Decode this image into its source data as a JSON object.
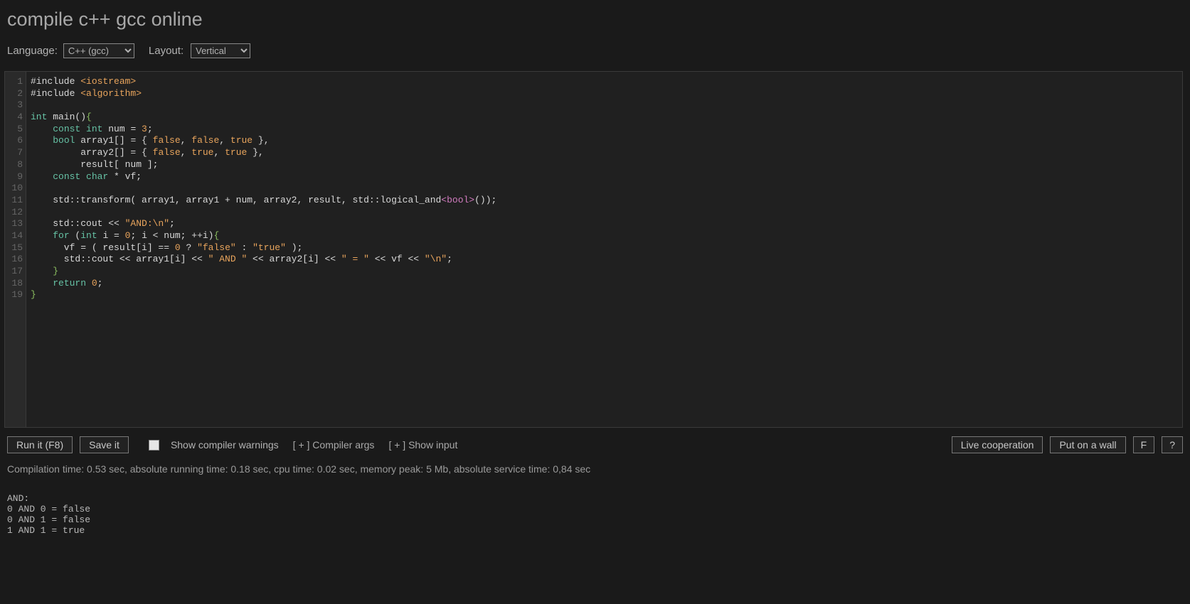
{
  "page_title": "compile c++ gcc online",
  "toolbar": {
    "language_label": "Language:",
    "language_value": "C++ (gcc)",
    "layout_label": "Layout:",
    "layout_value": "Vertical"
  },
  "editor": {
    "line_count": 19,
    "lines": [
      [
        {
          "t": "#include ",
          "c": ""
        },
        {
          "t": "<iostream>",
          "c": "fn"
        }
      ],
      [
        {
          "t": "#include ",
          "c": ""
        },
        {
          "t": "<algorithm>",
          "c": "fn"
        }
      ],
      [
        {
          "t": "",
          "c": ""
        }
      ],
      [
        {
          "t": "int",
          "c": "kw"
        },
        {
          "t": " main()",
          "c": ""
        },
        {
          "t": "{",
          "c": "brc"
        }
      ],
      [
        {
          "t": "    ",
          "c": ""
        },
        {
          "t": "const int",
          "c": "kw"
        },
        {
          "t": " num = ",
          "c": ""
        },
        {
          "t": "3",
          "c": "num"
        },
        {
          "t": ";",
          "c": ""
        }
      ],
      [
        {
          "t": "    ",
          "c": ""
        },
        {
          "t": "bool",
          "c": "kw"
        },
        {
          "t": " array1[] = { ",
          "c": ""
        },
        {
          "t": "false",
          "c": "bool"
        },
        {
          "t": ", ",
          "c": ""
        },
        {
          "t": "false",
          "c": "bool"
        },
        {
          "t": ", ",
          "c": ""
        },
        {
          "t": "true",
          "c": "bool"
        },
        {
          "t": " },",
          "c": ""
        }
      ],
      [
        {
          "t": "         array2[] = { ",
          "c": ""
        },
        {
          "t": "false",
          "c": "bool"
        },
        {
          "t": ", ",
          "c": ""
        },
        {
          "t": "true",
          "c": "bool"
        },
        {
          "t": ", ",
          "c": ""
        },
        {
          "t": "true",
          "c": "bool"
        },
        {
          "t": " },",
          "c": ""
        }
      ],
      [
        {
          "t": "         result[ num ];",
          "c": ""
        }
      ],
      [
        {
          "t": "    ",
          "c": ""
        },
        {
          "t": "const char",
          "c": "kw"
        },
        {
          "t": " * vf;",
          "c": ""
        }
      ],
      [
        {
          "t": "",
          "c": ""
        }
      ],
      [
        {
          "t": "    std::transform( array1, array1 + num, array2, result, std::logical_and",
          "c": ""
        },
        {
          "t": "<bool>",
          "c": "tpl"
        },
        {
          "t": "());",
          "c": ""
        }
      ],
      [
        {
          "t": "",
          "c": ""
        }
      ],
      [
        {
          "t": "    std::cout << ",
          "c": ""
        },
        {
          "t": "\"AND:\\n\"",
          "c": "str"
        },
        {
          "t": ";",
          "c": ""
        }
      ],
      [
        {
          "t": "    ",
          "c": ""
        },
        {
          "t": "for",
          "c": "kw"
        },
        {
          "t": " (",
          "c": ""
        },
        {
          "t": "int",
          "c": "kw"
        },
        {
          "t": " i = ",
          "c": ""
        },
        {
          "t": "0",
          "c": "num"
        },
        {
          "t": "; i < num; ++i)",
          "c": ""
        },
        {
          "t": "{",
          "c": "brc"
        }
      ],
      [
        {
          "t": "      vf = ( result[i] == ",
          "c": ""
        },
        {
          "t": "0",
          "c": "num"
        },
        {
          "t": " ? ",
          "c": ""
        },
        {
          "t": "\"false\"",
          "c": "str"
        },
        {
          "t": " : ",
          "c": ""
        },
        {
          "t": "\"true\"",
          "c": "str"
        },
        {
          "t": " );",
          "c": ""
        }
      ],
      [
        {
          "t": "      std::cout << array1[i] << ",
          "c": ""
        },
        {
          "t": "\" AND \"",
          "c": "str"
        },
        {
          "t": " << array2[i] << ",
          "c": ""
        },
        {
          "t": "\" = \"",
          "c": "str"
        },
        {
          "t": " << vf << ",
          "c": ""
        },
        {
          "t": "\"\\n\"",
          "c": "str"
        },
        {
          "t": ";",
          "c": ""
        }
      ],
      [
        {
          "t": "    ",
          "c": ""
        },
        {
          "t": "}",
          "c": "brc"
        }
      ],
      [
        {
          "t": "    ",
          "c": ""
        },
        {
          "t": "return",
          "c": "kw"
        },
        {
          "t": " ",
          "c": ""
        },
        {
          "t": "0",
          "c": "num"
        },
        {
          "t": ";",
          "c": ""
        }
      ],
      [
        {
          "t": "}",
          "c": "brc"
        }
      ]
    ]
  },
  "actions": {
    "run_label": "Run it (F8)",
    "save_label": "Save it",
    "show_warnings_label": "Show compiler warnings",
    "compiler_args_prefix": "[ + ]",
    "compiler_args_label": "Compiler args",
    "show_input_prefix": "[ + ]",
    "show_input_label": "Show input",
    "live_coop_label": "Live cooperation",
    "wall_label": "Put on a wall",
    "f_label": "F",
    "help_label": "?"
  },
  "status_line": "Compilation time: 0.53 sec, absolute running time: 0.18 sec, cpu time: 0.02 sec, memory peak: 5 Mb, absolute service time: 0,84 sec",
  "output_text": "AND:\n0 AND 0 = false\n0 AND 1 = false\n1 AND 1 = true"
}
